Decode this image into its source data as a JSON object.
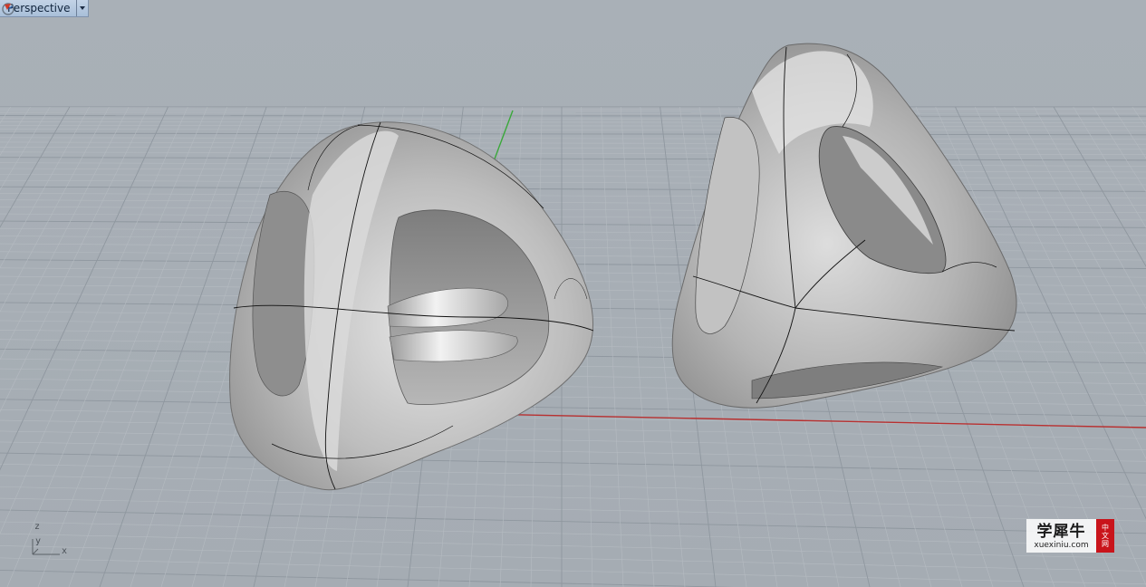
{
  "viewport": {
    "name": "Perspective",
    "colors": {
      "background": "#a7aeb5",
      "grid_minor": "#b5bbc1",
      "grid_major": "#8f979f",
      "x_axis": "#b83030",
      "y_axis": "#3aa83a",
      "surface": "#c8c8c8",
      "isocurve": "#141414"
    },
    "icons": {
      "dropdown": "dropdown-arrow-icon",
      "navigation": "rotate-view-icon"
    }
  },
  "axis_indicator": {
    "z": "z",
    "y": "y",
    "x": "x"
  },
  "watermark": {
    "chinese": "学犀牛",
    "url": "xuexiniu.com",
    "badge": [
      "中",
      "文",
      "网"
    ]
  }
}
